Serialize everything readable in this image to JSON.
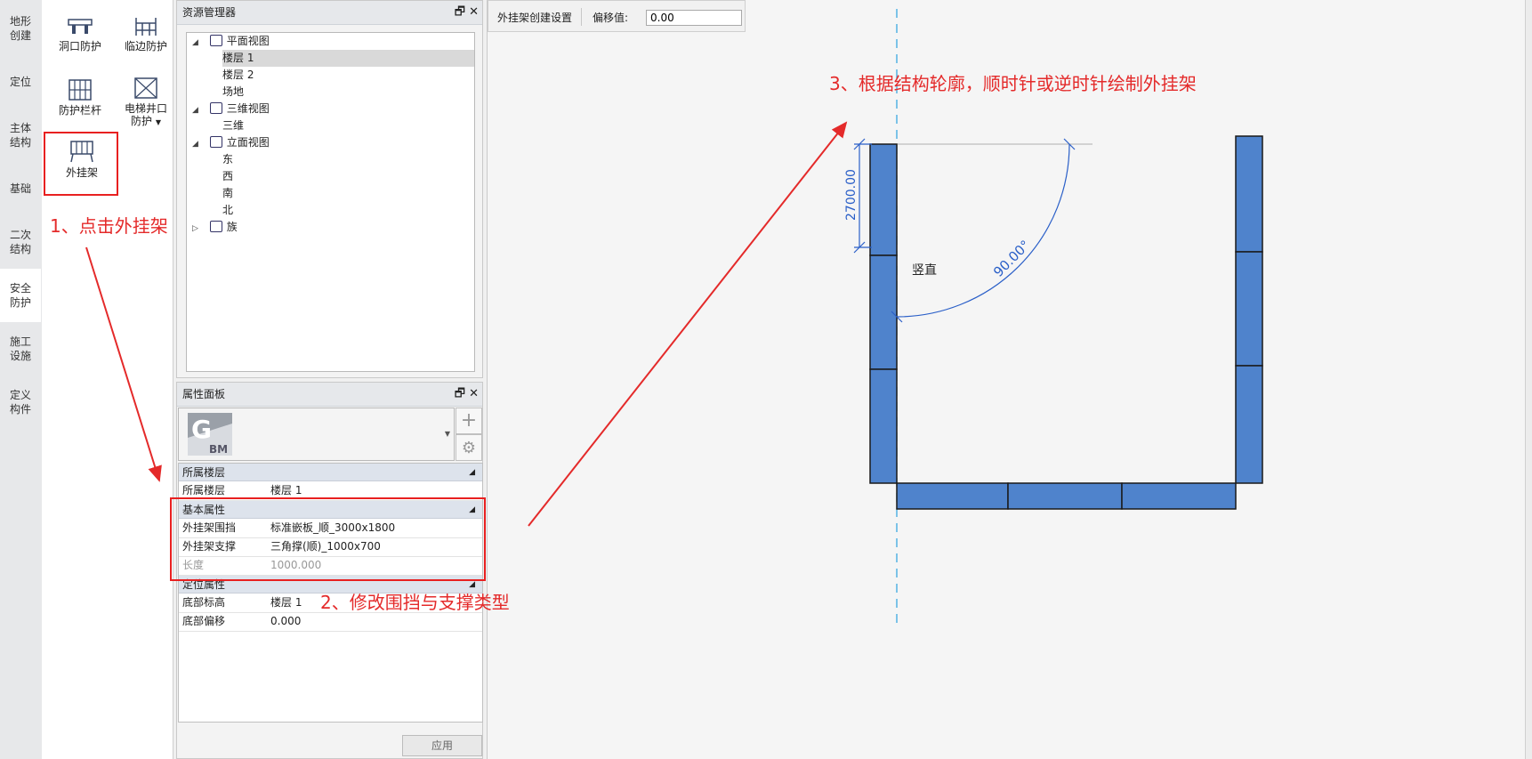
{
  "categories": [
    {
      "label": "地形\n创建",
      "active": false
    },
    {
      "label": "定位",
      "active": false
    },
    {
      "label": "主体\n结构",
      "active": false
    },
    {
      "label": "基础",
      "active": false
    },
    {
      "label": "二次\n结构",
      "active": false
    },
    {
      "label": "安全\n防护",
      "active": true
    },
    {
      "label": "施工\n设施",
      "active": false
    },
    {
      "label": "定义\n构件",
      "active": false
    }
  ],
  "tools": {
    "hole_protect": "洞口防护",
    "edge_protect": "临边防护",
    "railing": "防护栏杆",
    "elevator_1": "电梯井口",
    "elevator_2": "防护",
    "external_frame": "外挂架"
  },
  "resource_manager": {
    "title": "资源管理器",
    "tree": {
      "plan_views": "平面视图",
      "floor1": "楼层 1",
      "floor2": "楼层 2",
      "site": "场地",
      "views_3d": "三维视图",
      "view_3d": "三维",
      "elevation_views": "立面视图",
      "east": "东",
      "west": "西",
      "south": "南",
      "north": "北",
      "family": "族"
    }
  },
  "properties": {
    "title": "属性面板",
    "logo_text": "G BM",
    "groups": {
      "floor": "所属楼层",
      "basic": "基本属性",
      "position": "定位属性"
    },
    "rows": {
      "floor_k": "所属楼层",
      "floor_v": "楼层 1",
      "fence_k": "外挂架围挡",
      "fence_v": "标准嵌板_顺_3000x1800",
      "support_k": "外挂架支撑",
      "support_v": "三角撑(顺)_1000x700",
      "length_k": "长度",
      "length_v": "1000.000",
      "base_level_k": "底部标高",
      "base_level_v": "楼层 1",
      "base_offset_k": "底部偏移",
      "base_offset_v": "0.000"
    },
    "apply": "应用"
  },
  "canvas": {
    "settings_label": "外挂架创建设置",
    "offset_label": "偏移值:",
    "offset_value": "0.00",
    "dim_value": "2700.00",
    "angle_value": "90.00°",
    "vertical_label": "竖直"
  },
  "annotations": {
    "step1": "1、点击外挂架",
    "step2": "2、修改围挡与支撑类型",
    "step3": "3、根据结构轮廓，顺时针或逆时针绘制外挂架"
  },
  "colors": {
    "frame_fill": "#4f83cc",
    "dim_blue": "#2a5fc8",
    "annotation_red": "#e42a2a"
  }
}
